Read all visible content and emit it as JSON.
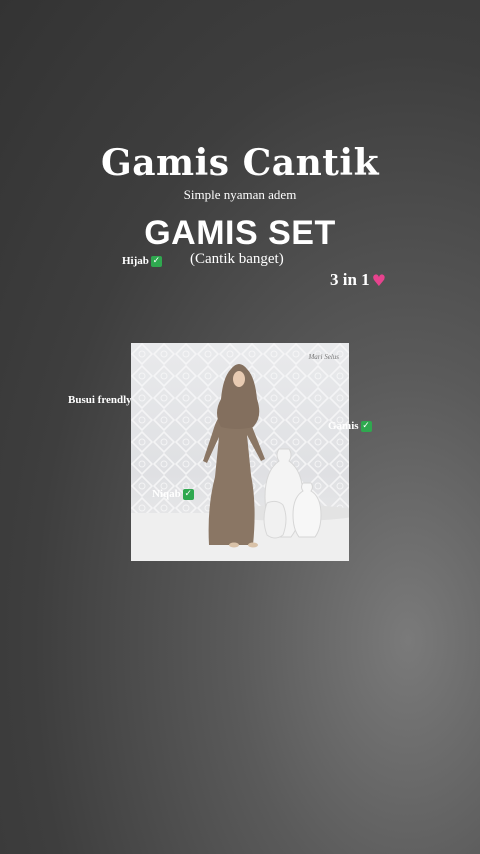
{
  "title": "Gamis Cantik",
  "subtitle": "Simple nyaman adem",
  "heading": "GAMIS SET",
  "note": "(Cantik banget)",
  "bundle": "3 in 1",
  "labels": {
    "hijab": "Hijab",
    "busui": "Busui frendly",
    "gamis": "Gamis",
    "niqab": "Niqab"
  },
  "photo": {
    "brand": "Mari Selus"
  },
  "icons": {
    "check": "check-mark-icon",
    "heart": "sparkling-heart-icon",
    "smile": "smile-icon"
  },
  "colors": {
    "check": "#2fa84f",
    "heart": "#e7438e",
    "dress": "#8a7664"
  }
}
